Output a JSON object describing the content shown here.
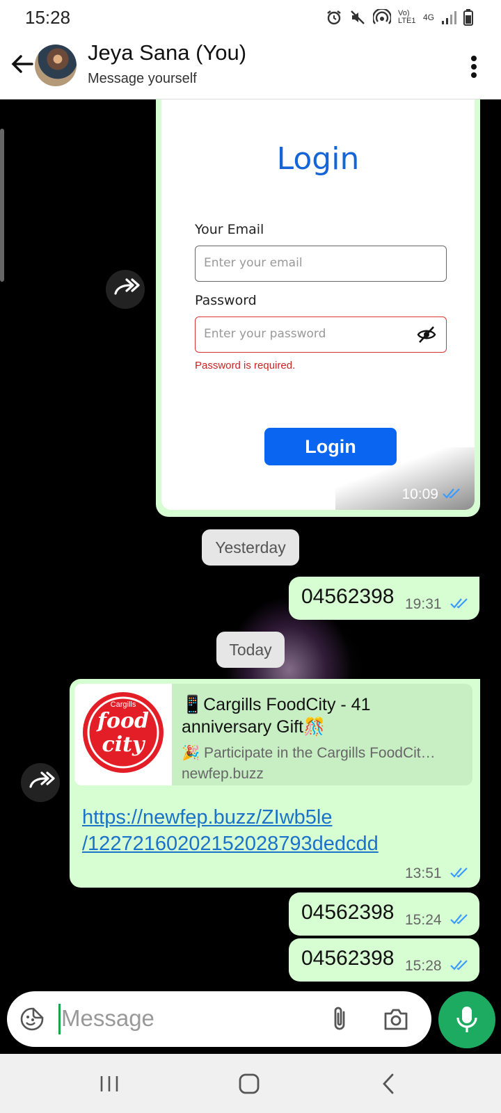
{
  "status_bar": {
    "time": "15:28",
    "network_label": "Vo) LTE1",
    "network_type": "4G"
  },
  "header": {
    "title": "Jeya Sana (You)",
    "subtitle": "Message yourself"
  },
  "image_message": {
    "login": {
      "title": "Login",
      "email_label": "Your Email",
      "email_placeholder": "Enter your email",
      "password_label": "Password",
      "password_placeholder": "Enter your password",
      "error_text": "Password is required.",
      "button_label": "Login"
    },
    "time": "10:09"
  },
  "date_pills": {
    "yesterday": "Yesterday",
    "today": "Today"
  },
  "messages": [
    {
      "text": "04562398",
      "time": "19:31"
    },
    {
      "text": "04562398",
      "time": "15:24"
    },
    {
      "text": "04562398",
      "time": "15:28"
    }
  ],
  "link_message": {
    "preview_title_line1": "📱Cargills FoodCity - 41",
    "preview_title_line2": "anniversary Gift🎊",
    "preview_description": "🎉 Participate in the Cargills FoodCit…",
    "preview_domain": "newfep.buzz",
    "thumb_brand_top": "Cargills",
    "thumb_brand_main1": "food",
    "thumb_brand_main2": "city",
    "link_line1": "https://newfep.buzz/ZIwb5le",
    "link_line2": "/1227216020215202879​3dedcdd",
    "time": "13:51"
  },
  "composer": {
    "placeholder": "Message"
  },
  "colors": {
    "outgoing_bubble": "#d7fdd2",
    "accent_green": "#1daa61",
    "read_ticks": "#3a9bff",
    "link": "#1a73c8"
  }
}
